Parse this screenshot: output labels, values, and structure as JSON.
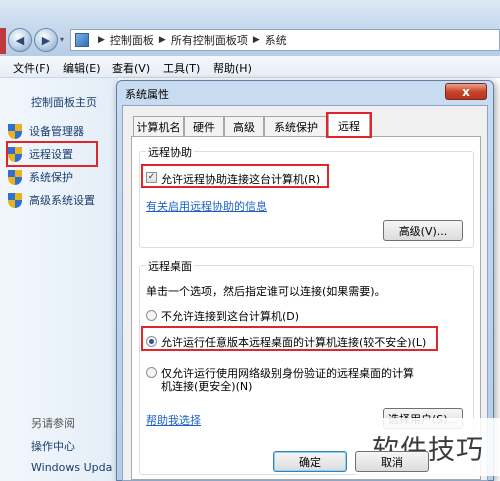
{
  "explorer": {
    "breadcrumb": [
      "控制面板",
      "所有控制面板项",
      "系统"
    ],
    "menu": [
      "文件(F)",
      "编辑(E)",
      "查看(V)",
      "工具(T)",
      "帮助(H)"
    ],
    "left_pane": {
      "home": "控制面板主页",
      "links": [
        "设备管理器",
        "远程设置",
        "系统保护",
        "高级系统设置"
      ],
      "see_also": "另请参阅",
      "see_also_links": [
        "操作中心",
        "Windows Upda"
      ]
    }
  },
  "dialog": {
    "title": "系统属性",
    "close": "x",
    "tabs": [
      "计算机名",
      "硬件",
      "高级",
      "系统保护",
      "远程"
    ],
    "active_tab": "远程",
    "remote_assistance": {
      "title": "远程协助",
      "checkbox_label": "允许远程协助连接这台计算机(R)",
      "checkbox_checked": true,
      "checkbox_mark": "✓",
      "info_link": "有关启用远程协助的信息",
      "advanced_button": "高级(V)..."
    },
    "remote_desktop": {
      "title": "远程桌面",
      "instruction": "单击一个选项，然后指定谁可以连接(如果需要)。",
      "options": [
        "不允许连接到这台计算机(D)",
        "允许运行任意版本远程桌面的计算机连接(较不安全)(L)",
        "仅允许运行使用网络级别身份验证的远程桌面的计算",
        "机连接(更安全)(N)"
      ],
      "selected_option": 1,
      "help_link": "帮助我选择",
      "select_users_button": "选择用户(S)..."
    },
    "ok_button": "确定",
    "cancel_button": "取消"
  },
  "watermark": "软件技巧",
  "colors": {
    "highlight": "#e0252b",
    "link": "#1b60c4"
  }
}
